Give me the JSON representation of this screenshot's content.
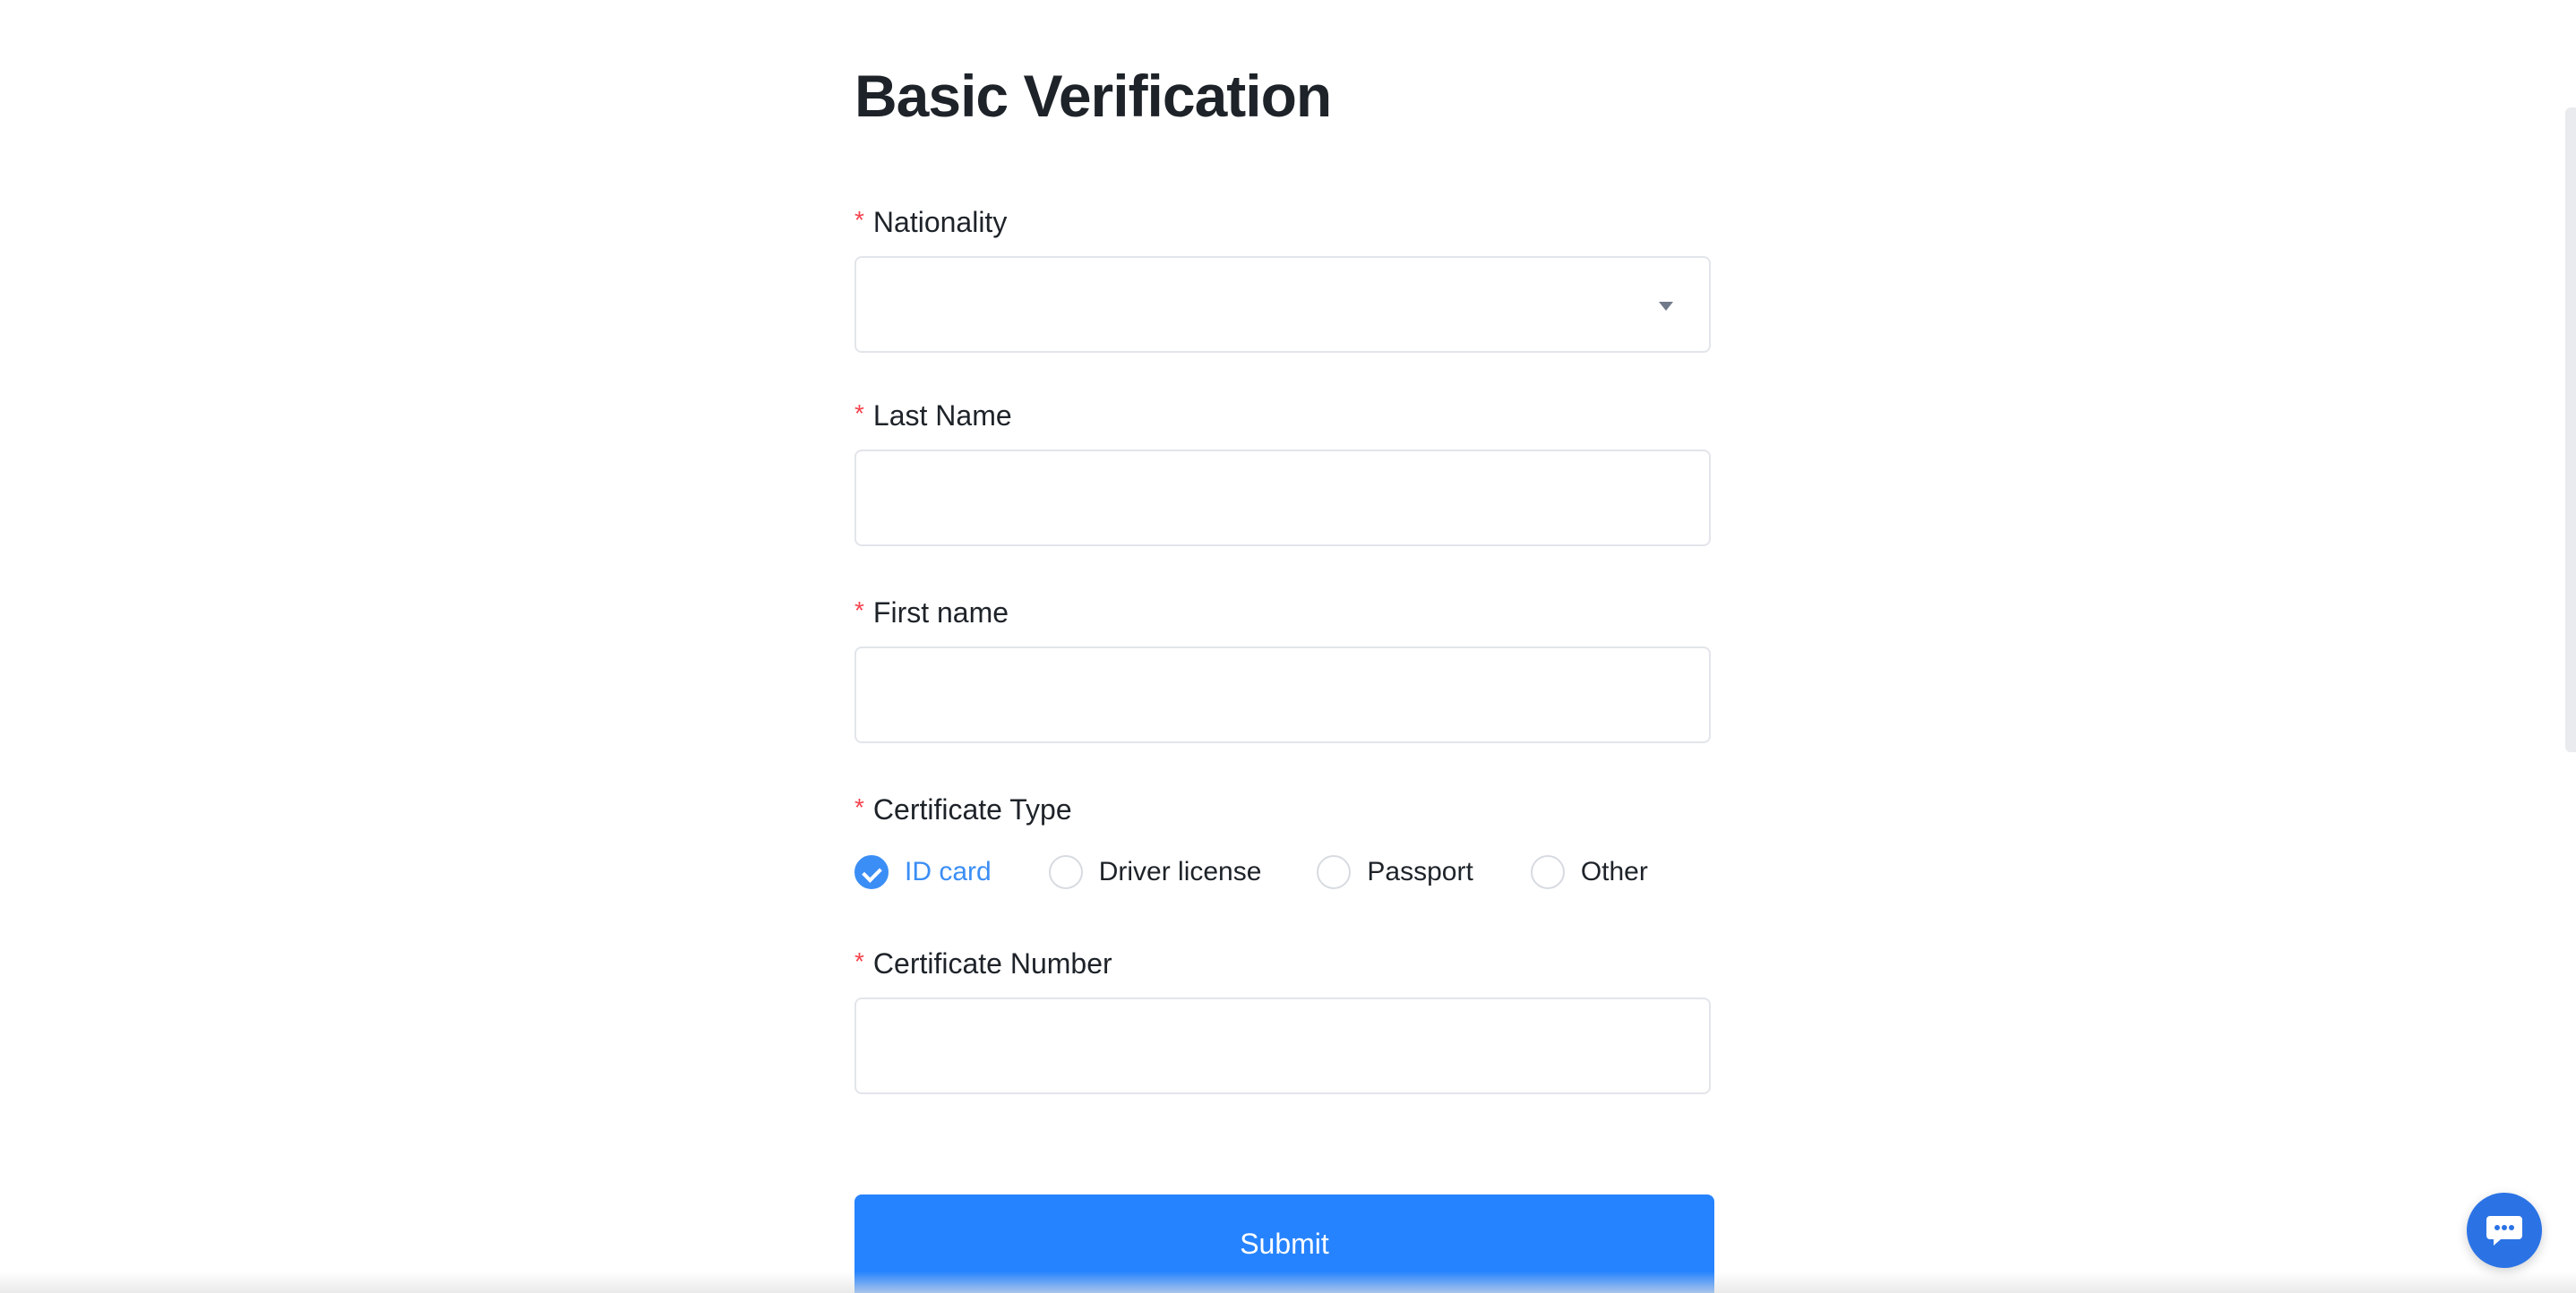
{
  "form": {
    "title": "Basic Verification",
    "required_marker": "*",
    "nationality": {
      "label": "Nationality",
      "value": ""
    },
    "last_name": {
      "label": "Last Name",
      "value": ""
    },
    "first_name": {
      "label": "First name",
      "value": ""
    },
    "certificate_type": {
      "label": "Certificate Type",
      "options": [
        "ID card",
        "Driver license",
        "Passport",
        "Other"
      ],
      "selected": "ID card"
    },
    "certificate_number": {
      "label": "Certificate Number",
      "value": ""
    },
    "submit_label": "Submit"
  },
  "chat": {
    "icon": "chat-bubble-icon"
  },
  "colors": {
    "accent": "#2683ff",
    "required": "#f5424d",
    "text": "#1e2329",
    "border": "#e2e5ea",
    "chat": "#2b73e5"
  }
}
